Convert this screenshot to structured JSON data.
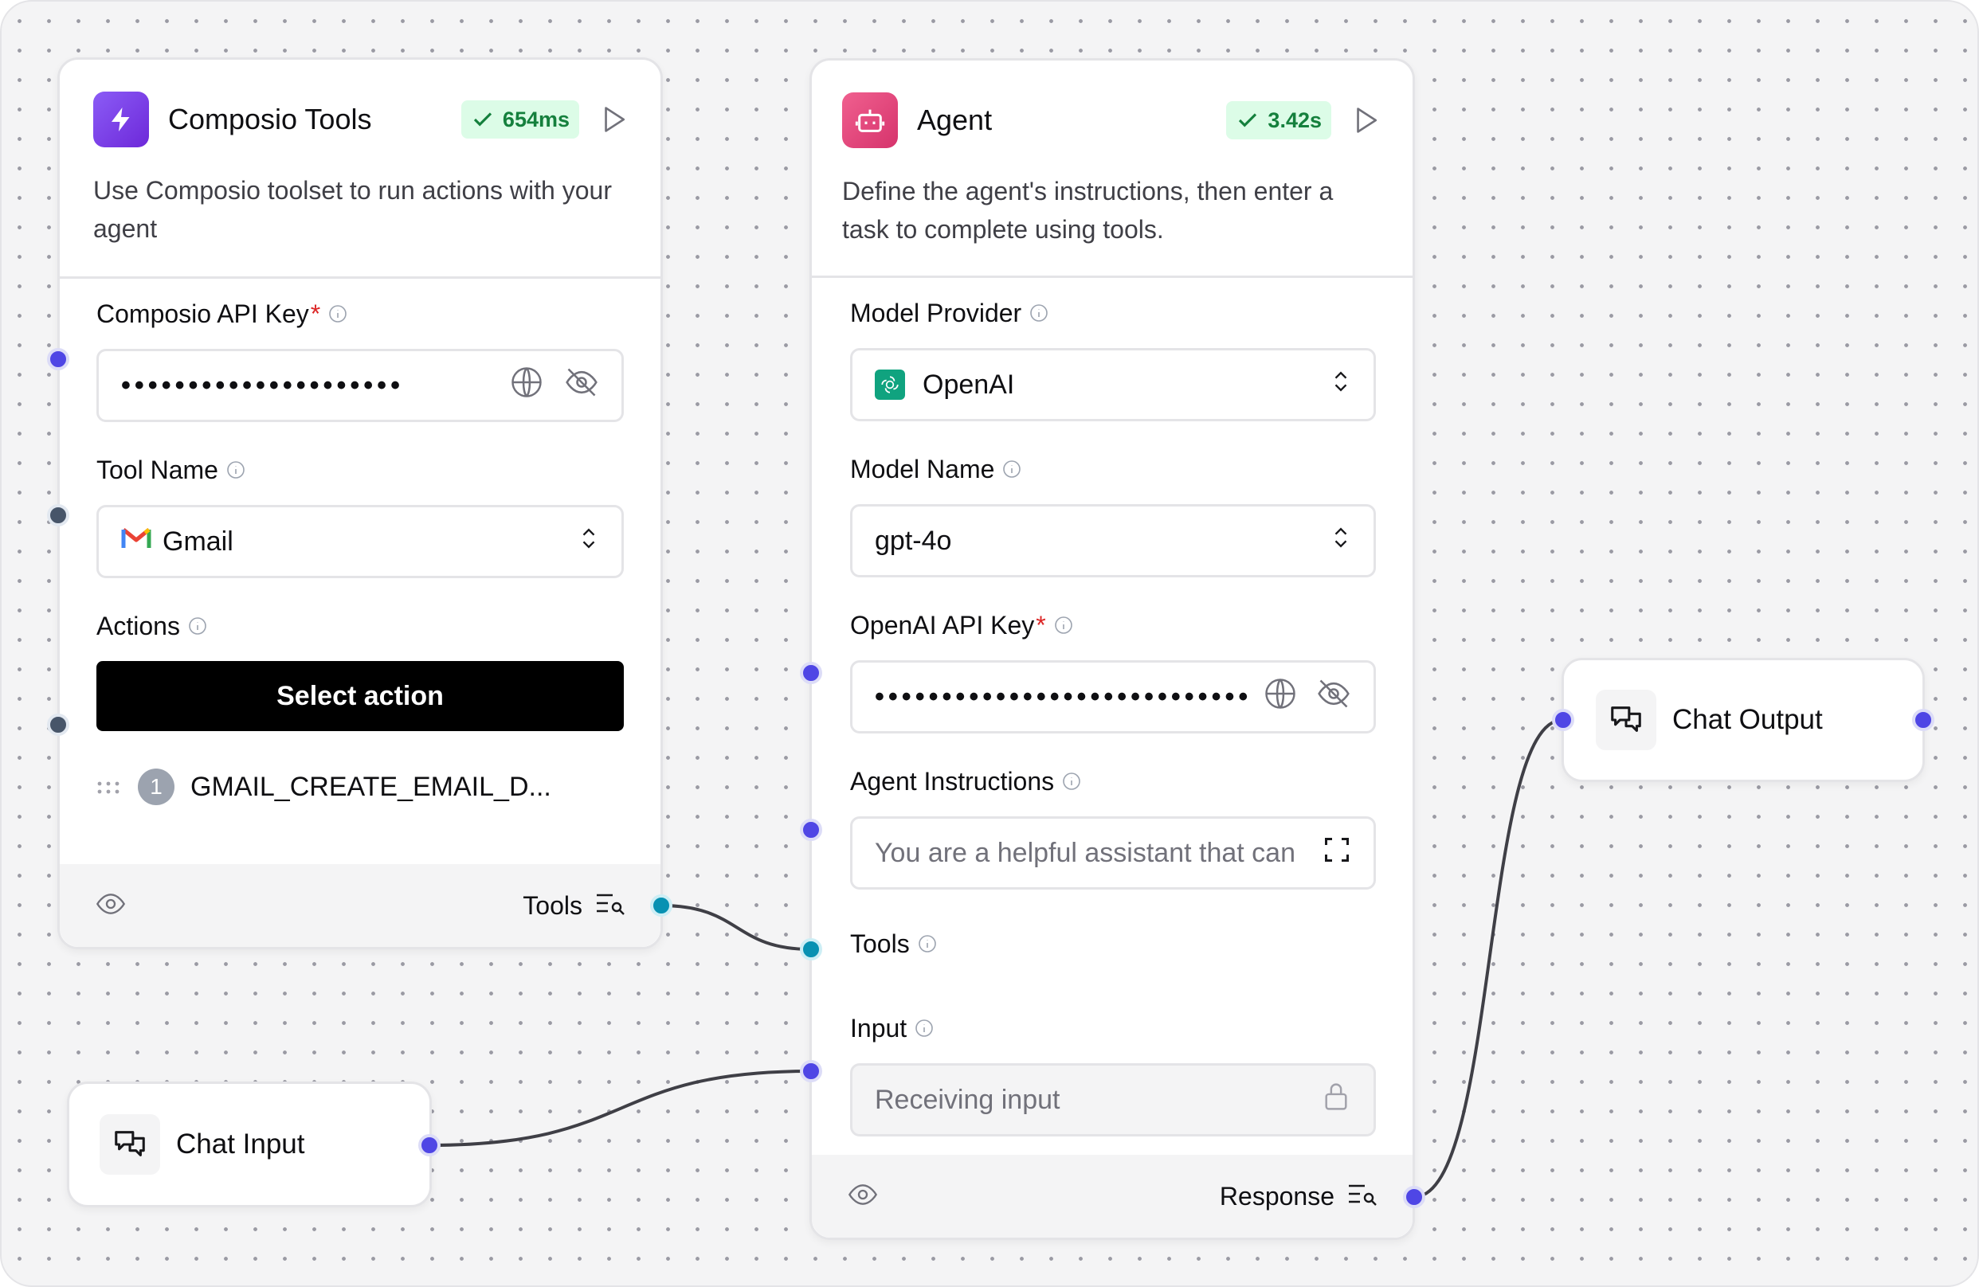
{
  "composio_node": {
    "title": "Composio Tools",
    "badge": "654ms",
    "description": "Use Composio toolset to run actions with your agent",
    "api_key_label": "Composio API Key",
    "api_key_value": "•••••••••••••••••••••",
    "tool_name_label": "Tool Name",
    "tool_name_value": "Gmail",
    "actions_label": "Actions",
    "select_action_button": "Select action",
    "action_items": [
      {
        "number": "1",
        "label": "GMAIL_CREATE_EMAIL_D..."
      }
    ],
    "footer_output": "Tools"
  },
  "agent_node": {
    "title": "Agent",
    "badge": "3.42s",
    "description": "Define the agent's instructions, then enter a task to complete using tools.",
    "model_provider_label": "Model Provider",
    "model_provider_value": "OpenAI",
    "model_name_label": "Model Name",
    "model_name_value": "gpt-4o",
    "api_key_label": "OpenAI API Key",
    "api_key_value": "••••••••••••••••••••••••••••",
    "instructions_label": "Agent Instructions",
    "instructions_placeholder": "You are a helpful assistant that can",
    "tools_label": "Tools",
    "input_label": "Input",
    "input_placeholder": "Receiving input",
    "footer_output": "Response"
  },
  "chat_input_node": {
    "title": "Chat Input"
  },
  "chat_output_node": {
    "title": "Chat Output"
  },
  "colors": {
    "handle_blue": "#4f46e5",
    "handle_teal": "#0891b2",
    "handle_gray": "#475569",
    "composio_icon": "#7c3aed",
    "agent_icon": "#e0457b",
    "success": "#15803d"
  }
}
